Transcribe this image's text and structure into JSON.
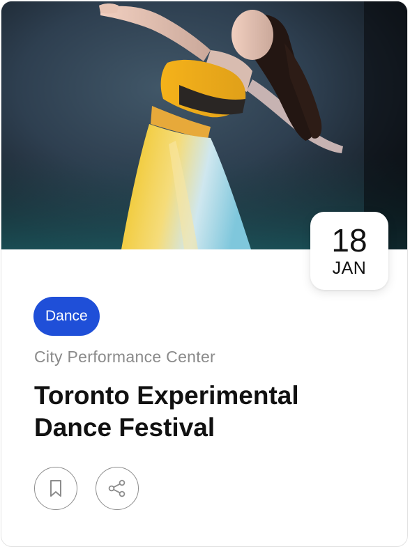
{
  "event": {
    "category": "Dance",
    "venue": "City Performance Center",
    "title": "Toronto Experimental Dance Festival",
    "date": {
      "day": "18",
      "month": "JAN"
    }
  },
  "image": {
    "subject": "dancer-photo"
  },
  "actions": {
    "bookmark_icon": "bookmark-icon",
    "share_icon": "share-icon"
  },
  "colors": {
    "category_pill": "#1f4fd8",
    "venue_text": "#8a8a8a",
    "title_text": "#111111",
    "icon_stroke": "#8c8c8c"
  }
}
